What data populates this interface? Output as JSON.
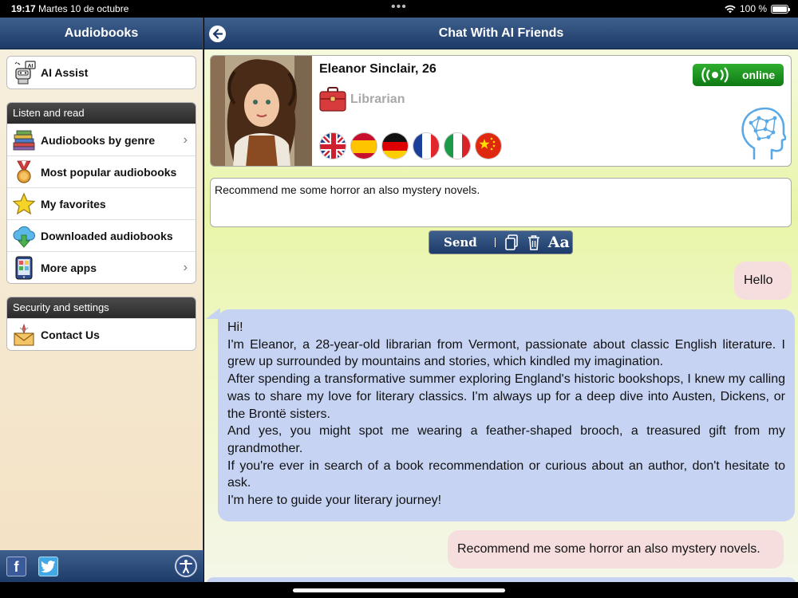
{
  "status_bar": {
    "time": "19:17",
    "date": "Martes 10 de octubre",
    "battery_percent": "100 %",
    "battery_level": 1.0
  },
  "sidebar": {
    "title": "Audiobooks",
    "ai_assist": {
      "label": "AI Assist",
      "icon": "robot-icon",
      "badge": "AI"
    },
    "sections": [
      {
        "title": "Listen and read",
        "items": [
          {
            "label": "Audiobooks by genre",
            "icon": "books-icon",
            "has_chevron": true
          },
          {
            "label": "Most popular audiobooks",
            "icon": "medal-icon",
            "has_chevron": false
          },
          {
            "label": "My favorites",
            "icon": "star-icon",
            "has_chevron": false
          },
          {
            "label": "Downloaded audiobooks",
            "icon": "cloud-download-icon",
            "has_chevron": false
          },
          {
            "label": "More apps",
            "icon": "tablet-icon",
            "has_chevron": true
          }
        ]
      },
      {
        "title": "Security and settings",
        "items": [
          {
            "label": "Contact Us",
            "icon": "mail-icon",
            "has_chevron": false
          }
        ]
      }
    ],
    "footer": {
      "facebook": "f"
    }
  },
  "chat": {
    "title": "Chat With AI Friends",
    "profile": {
      "name": "Eleanor Sinclair, 26",
      "profession": "Librarian",
      "status": "online",
      "flags": [
        "uk-flag-icon",
        "spain-flag-icon",
        "germany-flag-icon",
        "france-flag-icon",
        "italy-flag-icon",
        "china-flag-icon"
      ]
    },
    "input_value": "Recommend me some horror an also mystery novels.",
    "toolbar": {
      "send_label": "Send",
      "font_label": "Aa"
    },
    "messages": [
      {
        "from": "user",
        "text": "Hello"
      },
      {
        "from": "ai",
        "lines": [
          "Hi!",
          "I'm Eleanor, a 28-year-old librarian from Vermont, passionate about classic English literature. I grew up surrounded by mountains and stories, which kindled my imagination.",
          "After spending a transformative summer exploring England's historic bookshops, I knew my calling was to share my love for literary classics. I'm always up for a deep dive into Austen, Dickens, or the Brontë sisters.",
          "And yes, you might spot me wearing a feather-shaped brooch, a treasured gift from my grandmother.",
          "If you're ever in search of a book recommendation or curious about an author, don't hesitate to ask.",
          "I'm here to guide your literary journey!"
        ]
      },
      {
        "from": "user",
        "text": "Recommend me some horror an also mystery novels."
      }
    ]
  },
  "colors": {
    "nav_blue": "#1d3b69",
    "online_green": "#1a8f1e",
    "user_bubble": "#f6dede",
    "ai_bubble": "#c6d3f2"
  }
}
